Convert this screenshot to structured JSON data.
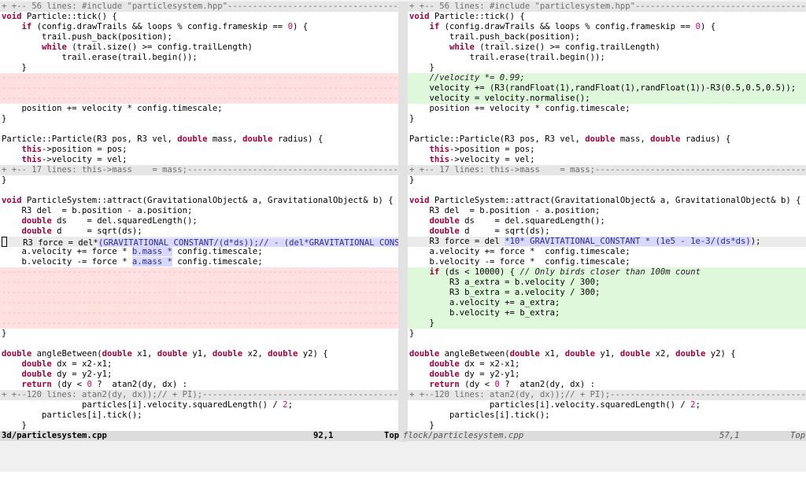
{
  "left": {
    "lines": [
      {
        "type": "fold",
        "segs": [
          {
            "t": "+ +-- 56 lines: #include \"particlesystem.hpp\"------------------------------------------------------------------------------"
          }
        ]
      },
      {
        "type": "normal",
        "segs": [
          {
            "t": "void",
            "c": "kw"
          },
          {
            "t": " Particle::tick() {"
          }
        ]
      },
      {
        "type": "normal",
        "segs": [
          {
            "t": "    "
          },
          {
            "t": "if",
            "c": "kw"
          },
          {
            "t": " (config.drawTrails && loops % config.frameskip == "
          },
          {
            "t": "0",
            "c": "num"
          },
          {
            "t": ") {"
          }
        ]
      },
      {
        "type": "normal",
        "segs": [
          {
            "t": "        trail.push_back(position);"
          }
        ]
      },
      {
        "type": "normal",
        "segs": [
          {
            "t": "        "
          },
          {
            "t": "while",
            "c": "kw"
          },
          {
            "t": " (trail.size() >= config.trailLength)"
          }
        ]
      },
      {
        "type": "normal",
        "segs": [
          {
            "t": "            trail.erase(trail.begin());"
          }
        ]
      },
      {
        "type": "normal",
        "segs": [
          {
            "t": "    }"
          }
        ]
      },
      {
        "type": "del",
        "segs": [
          {
            "t": "----------------------------------------------------------------------------------------------------------------------"
          }
        ]
      },
      {
        "type": "del",
        "segs": [
          {
            "t": "----------------------------------------------------------------------------------------------------------------------"
          }
        ]
      },
      {
        "type": "del",
        "segs": [
          {
            "t": "----------------------------------------------------------------------------------------------------------------------"
          }
        ]
      },
      {
        "type": "normal",
        "segs": [
          {
            "t": "    position += velocity * config.timescale;"
          }
        ]
      },
      {
        "type": "normal",
        "segs": [
          {
            "t": "}"
          }
        ]
      },
      {
        "type": "normal",
        "segs": [
          {
            "t": ""
          }
        ]
      },
      {
        "type": "normal",
        "segs": [
          {
            "t": "Particle::Particle(R3 pos, R3 vel, "
          },
          {
            "t": "double",
            "c": "kw"
          },
          {
            "t": " mass, "
          },
          {
            "t": "double",
            "c": "kw"
          },
          {
            "t": " radius) {"
          }
        ]
      },
      {
        "type": "normal",
        "segs": [
          {
            "t": "    "
          },
          {
            "t": "this",
            "c": "kw"
          },
          {
            "t": "->position = pos;"
          }
        ]
      },
      {
        "type": "normal",
        "segs": [
          {
            "t": "    "
          },
          {
            "t": "this",
            "c": "kw"
          },
          {
            "t": "->velocity = vel;"
          }
        ]
      },
      {
        "type": "fold",
        "segs": [
          {
            "t": "+ +-- 17 lines: this->mass    = mass;------------------------------------------------------------------------------------"
          }
        ]
      },
      {
        "type": "normal",
        "segs": [
          {
            "t": "}"
          }
        ]
      },
      {
        "type": "normal",
        "segs": [
          {
            "t": ""
          }
        ]
      },
      {
        "type": "normal",
        "segs": [
          {
            "t": "void",
            "c": "kw"
          },
          {
            "t": " ParticleSystem::attract(GravitationalObject& a, GravitationalObject& b) {"
          }
        ]
      },
      {
        "type": "normal",
        "segs": [
          {
            "t": "    R3 del  = b.position - a.position;"
          }
        ]
      },
      {
        "type": "normal",
        "segs": [
          {
            "t": "    "
          },
          {
            "t": "double",
            "c": "kw"
          },
          {
            "t": " ds    = del.squaredLength();"
          }
        ]
      },
      {
        "type": "normal",
        "segs": [
          {
            "t": "    "
          },
          {
            "t": "double",
            "c": "kw"
          },
          {
            "t": " d     = sqrt(ds);"
          }
        ]
      },
      {
        "type": "chg",
        "cursor": true,
        "segs": [
          {
            "t": "   R3 force = del*"
          },
          {
            "t": "(GRAVITATIONAL_CONSTANT/(d*ds));// - (del*GRAVITATIONAL_CONSTANT",
            "c": "hl"
          }
        ]
      },
      {
        "type": "normal",
        "segs": [
          {
            "t": "    a.velocity += force * "
          },
          {
            "t": "b.mass *",
            "c": "hl"
          },
          {
            "t": " config.timescale;"
          }
        ]
      },
      {
        "type": "normal",
        "segs": [
          {
            "t": "    b.velocity -= force * "
          },
          {
            "t": "a.mass *",
            "c": "hl"
          },
          {
            "t": " config.timescale;"
          }
        ]
      },
      {
        "type": "del",
        "segs": [
          {
            "t": "----------------------------------------------------------------------------------------------------------------------"
          }
        ]
      },
      {
        "type": "del",
        "segs": [
          {
            "t": "----------------------------------------------------------------------------------------------------------------------"
          }
        ]
      },
      {
        "type": "del",
        "segs": [
          {
            "t": "----------------------------------------------------------------------------------------------------------------------"
          }
        ]
      },
      {
        "type": "del",
        "segs": [
          {
            "t": "----------------------------------------------------------------------------------------------------------------------"
          }
        ]
      },
      {
        "type": "del",
        "segs": [
          {
            "t": "----------------------------------------------------------------------------------------------------------------------"
          }
        ]
      },
      {
        "type": "del",
        "segs": [
          {
            "t": "----------------------------------------------------------------------------------------------------------------------"
          }
        ]
      },
      {
        "type": "normal",
        "segs": [
          {
            "t": "}"
          }
        ]
      },
      {
        "type": "normal",
        "segs": [
          {
            "t": ""
          }
        ]
      },
      {
        "type": "normal",
        "segs": [
          {
            "t": "double",
            "c": "kw"
          },
          {
            "t": " angleBetween("
          },
          {
            "t": "double",
            "c": "kw"
          },
          {
            "t": " x1, "
          },
          {
            "t": "double",
            "c": "kw"
          },
          {
            "t": " y1, "
          },
          {
            "t": "double",
            "c": "kw"
          },
          {
            "t": " x2, "
          },
          {
            "t": "double",
            "c": "kw"
          },
          {
            "t": " y2) {"
          }
        ]
      },
      {
        "type": "normal",
        "segs": [
          {
            "t": "    "
          },
          {
            "t": "double",
            "c": "kw"
          },
          {
            "t": " dx = x2-x1;"
          }
        ]
      },
      {
        "type": "normal",
        "segs": [
          {
            "t": "    "
          },
          {
            "t": "double",
            "c": "kw"
          },
          {
            "t": " dy = y2-y1;"
          }
        ]
      },
      {
        "type": "normal",
        "segs": [
          {
            "t": "    "
          },
          {
            "t": "return",
            "c": "kw"
          },
          {
            "t": " (dy < "
          },
          {
            "t": "0",
            "c": "num"
          },
          {
            "t": " ?  atan2(dy, dx) :"
          }
        ]
      },
      {
        "type": "fold",
        "segs": [
          {
            "t": "+ +--120 lines: atan2(dy, dx));// + PI);-----------------------------------------------------------------------------------"
          }
        ]
      },
      {
        "type": "normal",
        "segs": [
          {
            "t": "                particles[i].velocity.squaredLength() / "
          },
          {
            "t": "2",
            "c": "num"
          },
          {
            "t": ";"
          }
        ]
      },
      {
        "type": "normal",
        "segs": [
          {
            "t": "        particles[i].tick();"
          }
        ]
      },
      {
        "type": "normal",
        "segs": [
          {
            "t": "    }"
          }
        ]
      }
    ]
  },
  "right": {
    "lines": [
      {
        "type": "fold",
        "segs": [
          {
            "t": "+ +-- 56 lines: #include \"particlesystem.hpp\"------------------------------------------------------------------------------"
          }
        ]
      },
      {
        "type": "normal",
        "segs": [
          {
            "t": "void",
            "c": "kw"
          },
          {
            "t": " Particle::tick() {"
          }
        ]
      },
      {
        "type": "normal",
        "segs": [
          {
            "t": "    "
          },
          {
            "t": "if",
            "c": "kw"
          },
          {
            "t": " (config.drawTrails && loops % config.frameskip == "
          },
          {
            "t": "0",
            "c": "num"
          },
          {
            "t": ") {"
          }
        ]
      },
      {
        "type": "normal",
        "segs": [
          {
            "t": "        trail.push_back(position);"
          }
        ]
      },
      {
        "type": "normal",
        "segs": [
          {
            "t": "        "
          },
          {
            "t": "while",
            "c": "kw"
          },
          {
            "t": " (trail.size() >= config.trailLength)"
          }
        ]
      },
      {
        "type": "normal",
        "segs": [
          {
            "t": "            trail.erase(trail.begin());"
          }
        ]
      },
      {
        "type": "normal",
        "segs": [
          {
            "t": "    }"
          }
        ]
      },
      {
        "type": "add",
        "segs": [
          {
            "t": "    "
          },
          {
            "t": "//velocity *= 0.99;",
            "c": "cm"
          }
        ]
      },
      {
        "type": "add",
        "segs": [
          {
            "t": "    velocity += (R3(randFloat(1),randFloat(1),randFloat(1))-R3(0.5,0.5,0.5));"
          }
        ]
      },
      {
        "type": "add",
        "segs": [
          {
            "t": "    velocity = velocity.normalise();"
          }
        ]
      },
      {
        "type": "normal",
        "segs": [
          {
            "t": "    position += velocity * config.timescale;"
          }
        ]
      },
      {
        "type": "normal",
        "segs": [
          {
            "t": "}"
          }
        ]
      },
      {
        "type": "normal",
        "segs": [
          {
            "t": ""
          }
        ]
      },
      {
        "type": "normal",
        "segs": [
          {
            "t": "Particle::Particle(R3 pos, R3 vel, "
          },
          {
            "t": "double",
            "c": "kw"
          },
          {
            "t": " mass, "
          },
          {
            "t": "double",
            "c": "kw"
          },
          {
            "t": " radius) {"
          }
        ]
      },
      {
        "type": "normal",
        "segs": [
          {
            "t": "    "
          },
          {
            "t": "this",
            "c": "kw"
          },
          {
            "t": "->position = pos;"
          }
        ]
      },
      {
        "type": "normal",
        "segs": [
          {
            "t": "    "
          },
          {
            "t": "this",
            "c": "kw"
          },
          {
            "t": "->velocity = vel;"
          }
        ]
      },
      {
        "type": "fold",
        "segs": [
          {
            "t": "+ +-- 17 lines: this->mass    = mass;------------------------------------------------------------------------------------"
          }
        ]
      },
      {
        "type": "normal",
        "segs": [
          {
            "t": "}"
          }
        ]
      },
      {
        "type": "normal",
        "segs": [
          {
            "t": ""
          }
        ]
      },
      {
        "type": "normal",
        "segs": [
          {
            "t": "void",
            "c": "kw"
          },
          {
            "t": " ParticleSystem::attract(GravitationalObject& a, GravitationalObject& b) {"
          }
        ]
      },
      {
        "type": "normal",
        "segs": [
          {
            "t": "    R3 del  = b.position - a.position;"
          }
        ]
      },
      {
        "type": "normal",
        "segs": [
          {
            "t": "    "
          },
          {
            "t": "double",
            "c": "kw"
          },
          {
            "t": " ds    = del.squaredLength();"
          }
        ]
      },
      {
        "type": "normal",
        "segs": [
          {
            "t": "    "
          },
          {
            "t": "double",
            "c": "kw"
          },
          {
            "t": " d     = sqrt(ds);"
          }
        ]
      },
      {
        "type": "chg",
        "segs": [
          {
            "t": "    R3 force = del "
          },
          {
            "t": "*10* GRAVITATIONAL_CONSTANT * (1e5 - 1e-3/(ds*ds)",
            "c": "hl"
          },
          {
            "t": ");"
          }
        ]
      },
      {
        "type": "normal",
        "segs": [
          {
            "t": "    a.velocity += force *  config.timescale;"
          }
        ]
      },
      {
        "type": "normal",
        "segs": [
          {
            "t": "    b.velocity -= force *  config.timescale;"
          }
        ]
      },
      {
        "type": "add",
        "segs": [
          {
            "t": "    "
          },
          {
            "t": "if",
            "c": "kw"
          },
          {
            "t": " (ds < 10000) { "
          },
          {
            "t": "// Only birds closer than 100m count",
            "c": "cm"
          }
        ]
      },
      {
        "type": "add",
        "segs": [
          {
            "t": "        R3 a_extra = b.velocity / 300;"
          }
        ]
      },
      {
        "type": "add",
        "segs": [
          {
            "t": "        R3 b_extra = a.velocity / 300;"
          }
        ]
      },
      {
        "type": "add",
        "segs": [
          {
            "t": "        a.velocity += a_extra;"
          }
        ]
      },
      {
        "type": "add",
        "segs": [
          {
            "t": "        b.velocity += b_extra;"
          }
        ]
      },
      {
        "type": "add",
        "segs": [
          {
            "t": "    }"
          }
        ]
      },
      {
        "type": "normal",
        "segs": [
          {
            "t": "}"
          }
        ]
      },
      {
        "type": "normal",
        "segs": [
          {
            "t": ""
          }
        ]
      },
      {
        "type": "normal",
        "segs": [
          {
            "t": "double",
            "c": "kw"
          },
          {
            "t": " angleBetween("
          },
          {
            "t": "double",
            "c": "kw"
          },
          {
            "t": " x1, "
          },
          {
            "t": "double",
            "c": "kw"
          },
          {
            "t": " y1, "
          },
          {
            "t": "double",
            "c": "kw"
          },
          {
            "t": " x2, "
          },
          {
            "t": "double",
            "c": "kw"
          },
          {
            "t": " y2) {"
          }
        ]
      },
      {
        "type": "normal",
        "segs": [
          {
            "t": "    "
          },
          {
            "t": "double",
            "c": "kw"
          },
          {
            "t": " dx = x2-x1;"
          }
        ]
      },
      {
        "type": "normal",
        "segs": [
          {
            "t": "    "
          },
          {
            "t": "double",
            "c": "kw"
          },
          {
            "t": " dy = y2-y1;"
          }
        ]
      },
      {
        "type": "normal",
        "segs": [
          {
            "t": "    "
          },
          {
            "t": "return",
            "c": "kw"
          },
          {
            "t": " (dy < "
          },
          {
            "t": "0",
            "c": "num"
          },
          {
            "t": " ?  atan2(dy, dx) :"
          }
        ]
      },
      {
        "type": "fold",
        "segs": [
          {
            "t": "+ +--120 lines: atan2(dy, dx));// + PI);-----------------------------------------------------------------------------------"
          }
        ]
      },
      {
        "type": "normal",
        "segs": [
          {
            "t": "                particles[i].velocity.squaredLength() / "
          },
          {
            "t": "2",
            "c": "num"
          },
          {
            "t": ";"
          }
        ]
      },
      {
        "type": "normal",
        "segs": [
          {
            "t": "        particles[i].tick();"
          }
        ]
      },
      {
        "type": "normal",
        "segs": [
          {
            "t": "    }"
          }
        ]
      }
    ]
  },
  "status": {
    "left": {
      "file": "3d/particlesystem.cpp",
      "pos": "92,1",
      "scroll": "Top"
    },
    "right": {
      "file": "flock/particlesystem.cpp",
      "pos": "57,1",
      "scroll": "Top"
    }
  }
}
